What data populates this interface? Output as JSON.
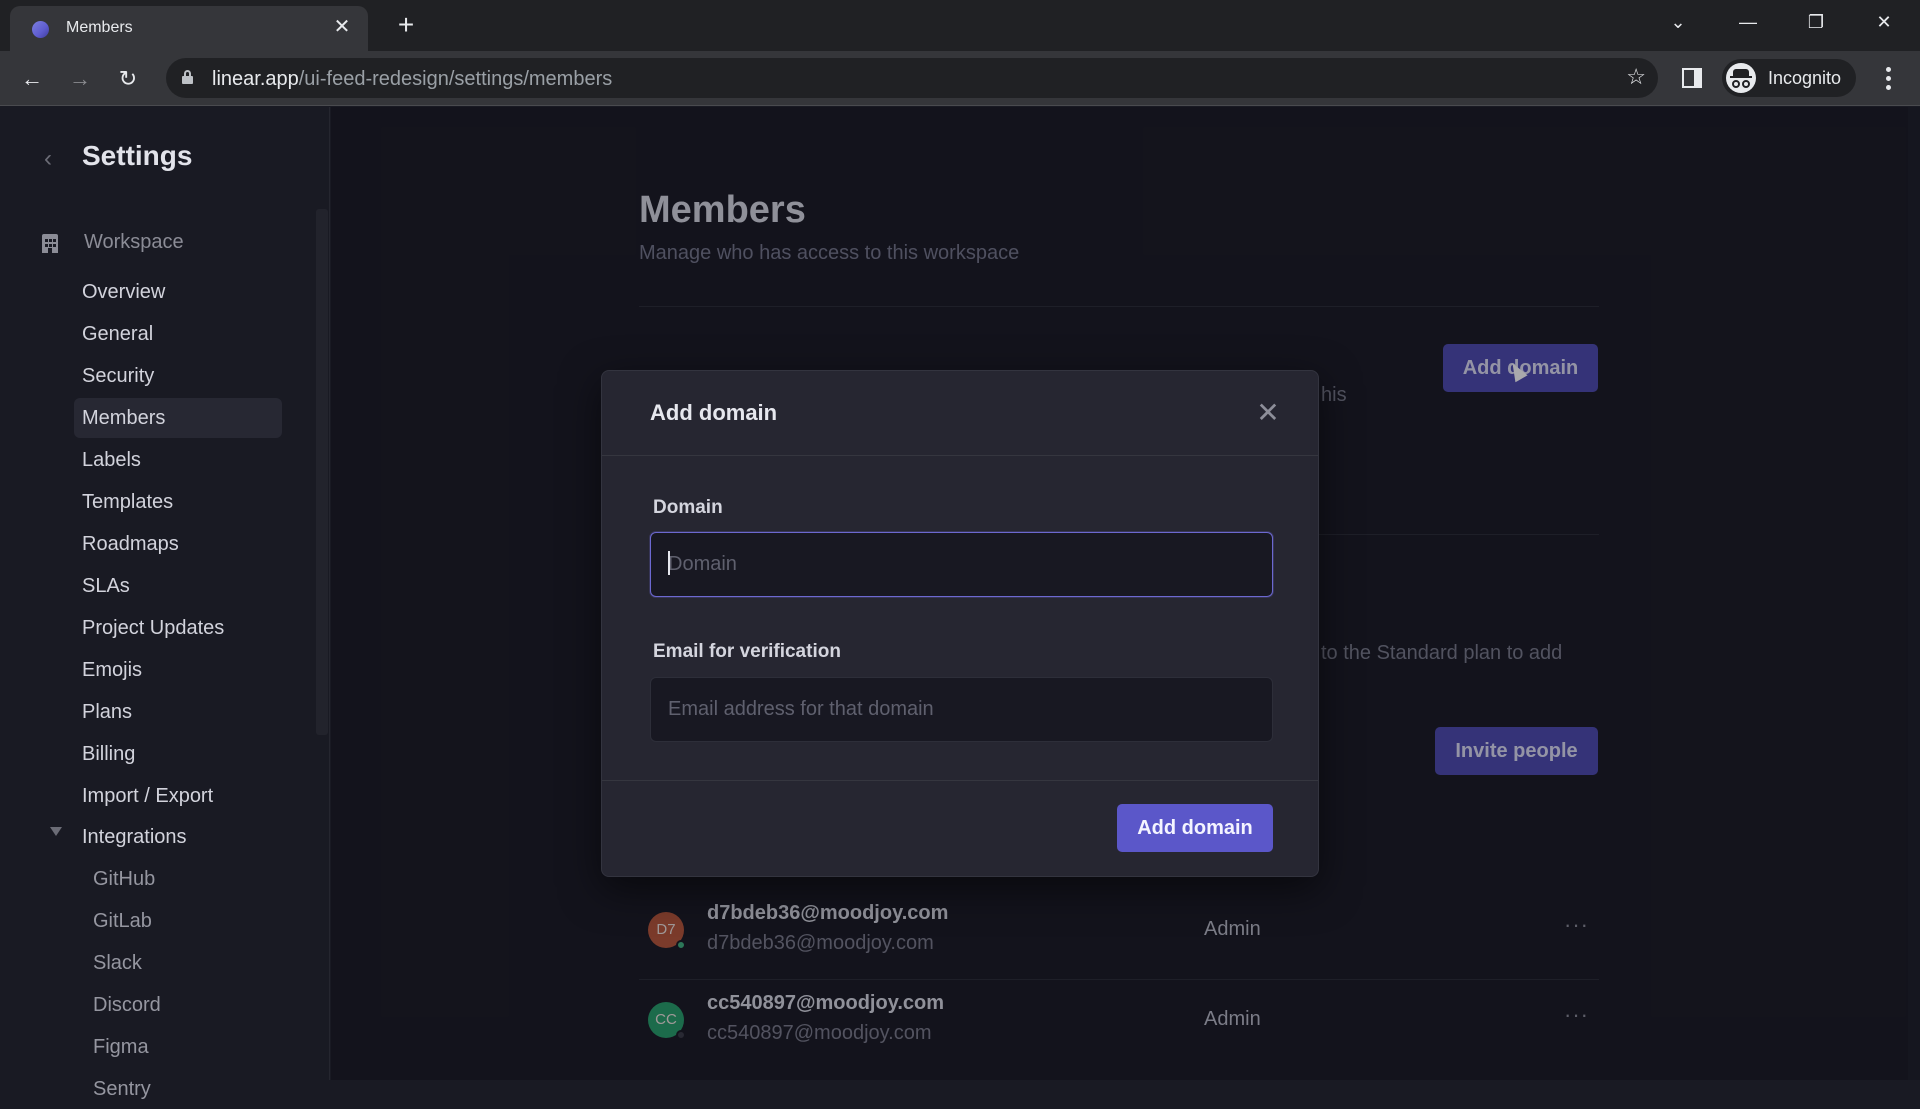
{
  "browser": {
    "tab": {
      "title": "Members",
      "favicon": "linear-logo-icon"
    },
    "new_tab_label": "+",
    "url_host": "linear.app",
    "url_path": "/ui-feed-redesign/settings/members",
    "profile_label": "Incognito",
    "window_controls": {
      "tab_search": "⌄",
      "minimize": "—",
      "restore": "❐",
      "close": "✕"
    },
    "nav": {
      "back": "←",
      "forward": "→",
      "reload": "↻"
    },
    "bookmark_icon": "☆"
  },
  "sidebar": {
    "back_glyph": "‹",
    "title": "Settings",
    "section": {
      "label": "Workspace",
      "icon": "building-icon"
    },
    "items": [
      {
        "label": "Overview",
        "active": false
      },
      {
        "label": "General",
        "active": false
      },
      {
        "label": "Security",
        "active": false
      },
      {
        "label": "Members",
        "active": true
      },
      {
        "label": "Labels",
        "active": false
      },
      {
        "label": "Templates",
        "active": false
      },
      {
        "label": "Roadmaps",
        "active": false
      },
      {
        "label": "SLAs",
        "active": false
      },
      {
        "label": "Project Updates",
        "active": false
      },
      {
        "label": "Emojis",
        "active": false
      },
      {
        "label": "Plans",
        "active": false
      },
      {
        "label": "Billing",
        "active": false
      },
      {
        "label": "Import / Export",
        "active": false
      }
    ],
    "integrations": {
      "label": "Integrations",
      "expanded": true,
      "items": [
        "GitHub",
        "GitLab",
        "Slack",
        "Discord",
        "Figma",
        "Sentry"
      ]
    }
  },
  "main": {
    "title": "Members",
    "subtitle": "Manage who has access to this workspace",
    "domain_section_fragment": "his",
    "add_domain_button": "Add domain",
    "plan_notice_fragment": "to the Standard plan to add",
    "invite_button": "Invite people",
    "members": [
      {
        "initials": "D7",
        "name": "d7bdeb36@moodjoy.com",
        "email": "d7bdeb36@moodjoy.com",
        "role": "Admin",
        "avatar_color": "#b8573a",
        "online": true,
        "more": "···"
      },
      {
        "initials": "CC",
        "name": "cc540897@moodjoy.com",
        "email": "cc540897@moodjoy.com",
        "role": "Admin",
        "avatar_color": "#27a06a",
        "online": false,
        "more": "···"
      }
    ]
  },
  "modal": {
    "title": "Add domain",
    "close_glyph": "✕",
    "domain_label": "Domain",
    "domain_value": "",
    "domain_placeholder": "Domain",
    "email_label": "Email for verification",
    "email_value": "",
    "email_placeholder": "Email address for that domain",
    "submit_label": "Add domain"
  },
  "colors": {
    "accent": "#5b57c9",
    "background": "#191a23",
    "modal_bg": "#262631",
    "online": "#3fb27f",
    "offline": "#3a3b46"
  }
}
